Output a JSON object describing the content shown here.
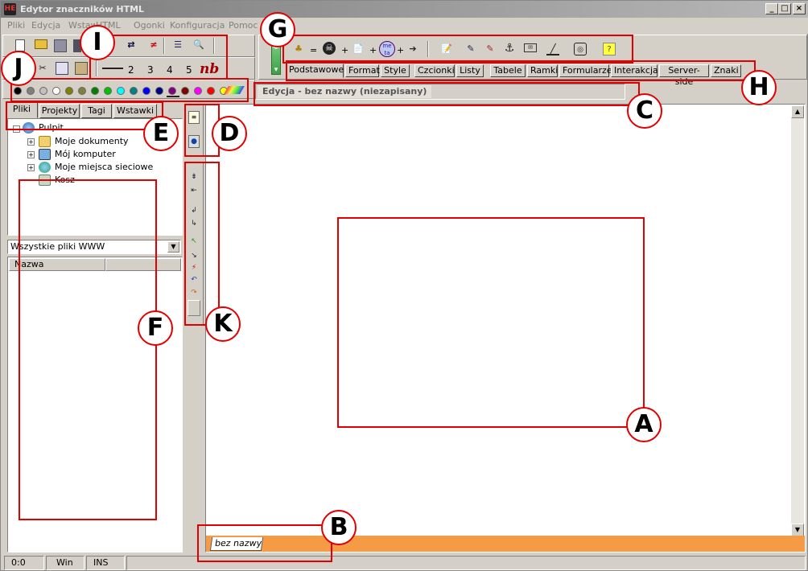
{
  "window": {
    "title": "Edytor znaczników HTML",
    "app_icon": "HE",
    "minimize": "_",
    "maximize": "□",
    "close": "×"
  },
  "menu": [
    "Pliki",
    "Edycja",
    "Wstaw",
    "HTML",
    "Ogonki",
    "Konfiguracja",
    "Pomoc"
  ],
  "heading_toolbar": {
    "sizes": [
      "2",
      "3",
      "4",
      "5"
    ],
    "nb": "nb"
  },
  "tag_toolbar": {
    "eq": "=",
    "plus": "+",
    "meta_label": "me ta"
  },
  "tag_tabs": [
    "Podstawowe",
    "Format",
    "Style",
    "Czcionki",
    "Listy",
    "Tabele",
    "Ramki",
    "Formularze",
    "Interakcja",
    "Server-side",
    "Znaki"
  ],
  "editor": {
    "caption": "Edycja - bez nazwy (niezapisany)",
    "doc_tab": "bez nazwy"
  },
  "left_tabs": [
    "Pliki",
    "Projekty",
    "Tagi",
    "Wstawki"
  ],
  "tree": {
    "root": "Pulpit",
    "items": [
      "Moje dokumenty",
      "Mój komputer",
      "Moje miejsca sieciowe",
      "Kosz"
    ]
  },
  "file_filter": {
    "value": "Wszystkie pliki WWW"
  },
  "file_list": {
    "column": "Nazwa"
  },
  "status": {
    "position": "0:0",
    "mode": "Win",
    "insert": "INS"
  },
  "colors": [
    "#000000",
    "#808080",
    "#c0c0c0",
    "#ffffff",
    "#808000",
    "#808040",
    "#008000",
    "#00c000",
    "#00ffff",
    "#008080",
    "#0000ff",
    "#000080",
    "#800080",
    "#800000",
    "#ff00ff",
    "#ff0000",
    "#ffff00",
    "#ffffff"
  ],
  "annotations": [
    "A",
    "B",
    "C",
    "D",
    "E",
    "F",
    "G",
    "H",
    "I",
    "J",
    "K"
  ],
  "accent": {
    "annotation": "#e00000",
    "doc_bar": "#f59a45"
  }
}
